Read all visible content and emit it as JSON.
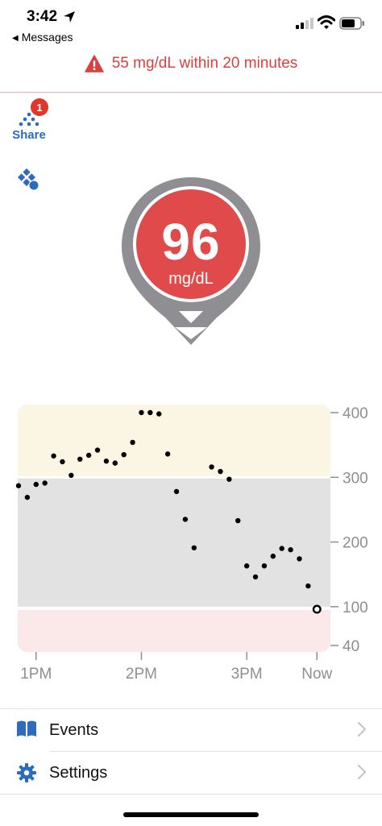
{
  "status_bar": {
    "time": "3:42",
    "back_label": "Messages",
    "icons": [
      "location-arrow-icon",
      "signal-icon",
      "wifi-icon",
      "battery-icon"
    ]
  },
  "alert": {
    "icon": "warning-triangle-icon",
    "text": "55 mg/dL within 20 minutes",
    "color": "#d94141"
  },
  "share": {
    "label": "Share",
    "badge_count": "1",
    "icon": "share-dots-icon"
  },
  "sensor": {
    "icon": "sensor-status-icon"
  },
  "reading": {
    "value": "96",
    "unit": "mg/dL",
    "trend": "down",
    "badge_color": "#e04a4a",
    "ring_color": "#8e8e93"
  },
  "chart_data": {
    "type": "scatter",
    "x_ticks": [
      "1PM",
      "2PM",
      "3PM",
      "Now"
    ],
    "y_ticks": [
      400,
      300,
      200,
      100,
      40
    ],
    "ylim": [
      40,
      420
    ],
    "zones": [
      {
        "name": "high",
        "from": 300,
        "to": 420,
        "color": "#fbf6e3"
      },
      {
        "name": "in-range",
        "from": 100,
        "to": 300,
        "color": "#e2e2e2"
      },
      {
        "name": "low",
        "from": 40,
        "to": 95,
        "color": "#fbe8e8"
      }
    ],
    "x_minutes": [
      0,
      5,
      10,
      15,
      20,
      25,
      30,
      35,
      40,
      45,
      50,
      55,
      60,
      65,
      70,
      75,
      80,
      85,
      90,
      95,
      100,
      110,
      115,
      120,
      125,
      130,
      135,
      140,
      145,
      150,
      155,
      160,
      165,
      170
    ],
    "values": [
      287,
      269,
      289,
      291,
      333,
      324,
      303,
      328,
      334,
      342,
      325,
      322,
      335,
      354,
      400,
      400,
      398,
      336,
      278,
      235,
      191,
      316,
      309,
      297,
      233,
      163,
      146,
      163,
      178,
      190,
      188,
      174,
      132,
      96
    ],
    "current_index": 33
  },
  "menu": {
    "items": [
      {
        "label": "Events",
        "icon": "book-icon"
      },
      {
        "label": "Settings",
        "icon": "gear-icon"
      }
    ]
  }
}
